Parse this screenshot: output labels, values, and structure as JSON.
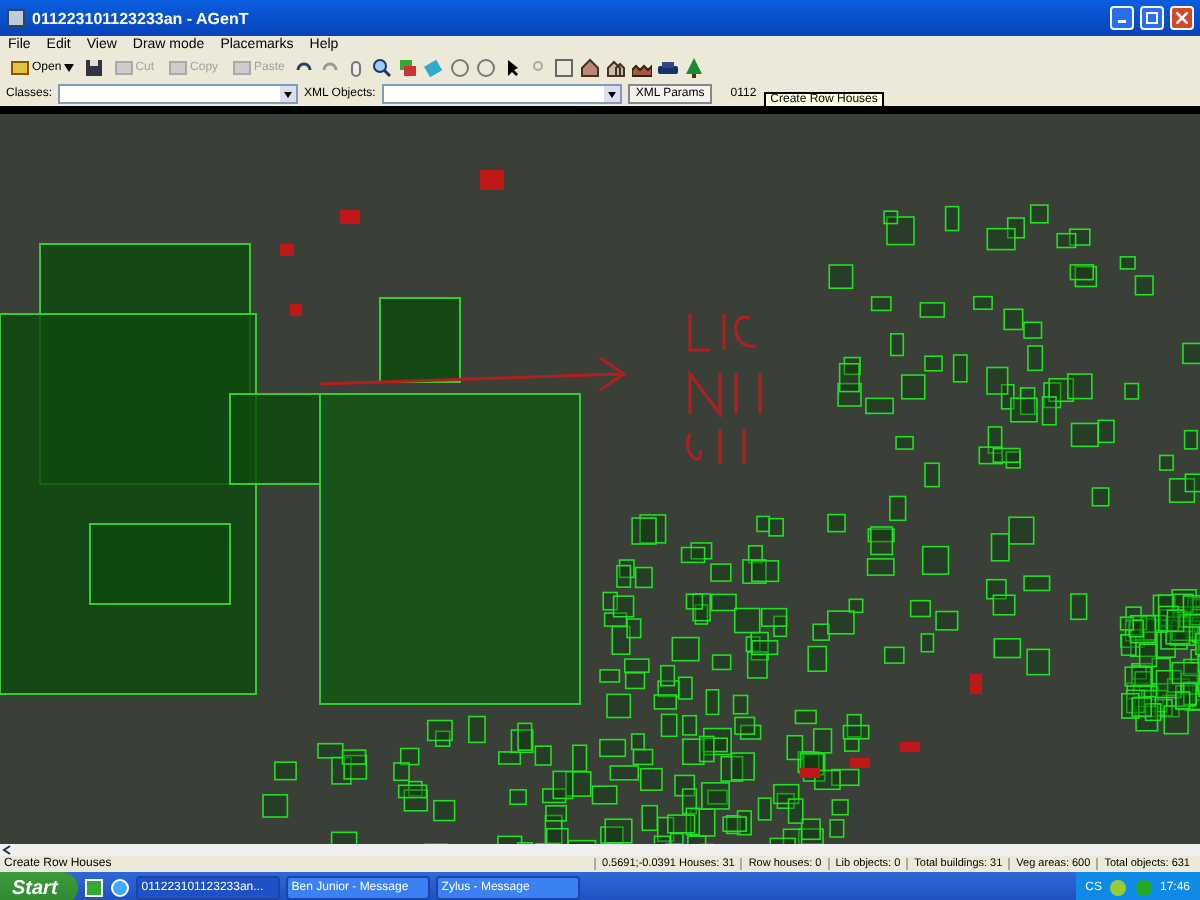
{
  "window": {
    "title": "011223101123233an - AGenT"
  },
  "menu": [
    "File",
    "Edit",
    "View",
    "Draw mode",
    "Placemarks",
    "Help"
  ],
  "toolbar": [
    {
      "kind": "split",
      "label": "Open",
      "disabled": false
    },
    {
      "kind": "button",
      "label": "Cut",
      "disabled": true
    },
    {
      "kind": "button",
      "label": "Copy",
      "disabled": true
    },
    {
      "kind": "button",
      "label": "Paste",
      "disabled": true
    }
  ],
  "fields": [
    {
      "label": "Classes:"
    },
    {
      "label": "XML Objects:"
    }
  ],
  "xml_params_button": "XML Params",
  "file_label": "0112",
  "tooltip": "Create Row Houses",
  "status_bar": {
    "message": "Create Row Houses",
    "stats": [
      "0.5691;-0.0391 Houses: 31",
      "Row houses: 0",
      "Lib objects: 0",
      "Total buildings: 31",
      "Veg areas: 600",
      "Total objects: 631"
    ]
  },
  "taskbar": {
    "start": "Start",
    "tasks": [
      {
        "label": "011223101123233an...",
        "selected": true
      },
      {
        "label": "Ben Junior - Message",
        "selected": false
      },
      {
        "label": "Zylus - Message",
        "selected": false
      }
    ],
    "language": "CS",
    "clock": "17:46"
  }
}
